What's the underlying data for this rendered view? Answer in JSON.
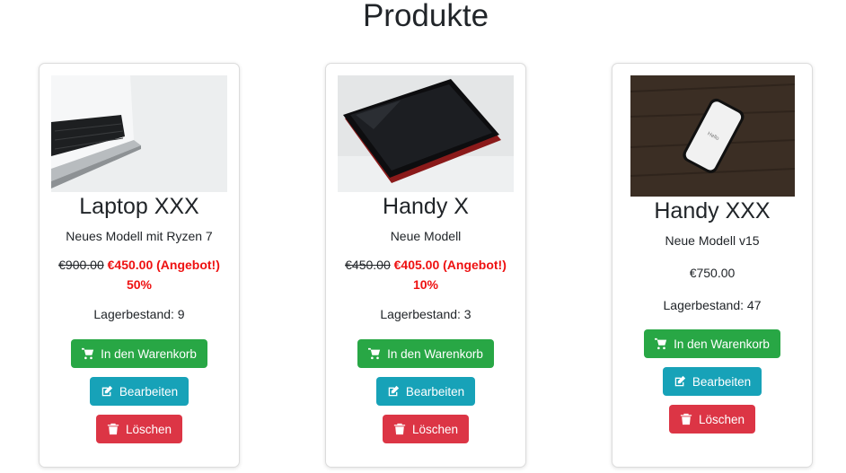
{
  "page": {
    "title": "Produkte"
  },
  "products": [
    {
      "name": "Laptop XXX",
      "description": "Neues Modell mit Ryzen 7",
      "old_price": "€900.00",
      "new_price": "€450.00 (Angebot!)",
      "discount": "50%",
      "stock": "Lagerbestand: 9",
      "image_icon": "laptop-photo"
    },
    {
      "name": "Handy X",
      "description": "Neue Modell",
      "old_price": "€450.00",
      "new_price": "€405.00 (Angebot!)",
      "discount": "10%",
      "stock": "Lagerbestand: 3",
      "image_icon": "phone-photo"
    },
    {
      "name": "Handy XXX",
      "description": "Neue Modell v15",
      "price": "€750.00",
      "stock": "Lagerbestand: 47",
      "image_icon": "phone-on-wood-photo",
      "image_screen_text": "Hello"
    }
  ],
  "buttons": {
    "cart_label": "In den Warenkorb",
    "edit_label": "Bearbeiten",
    "delete_label": "Löschen"
  },
  "colors": {
    "cart": "#28a745",
    "edit": "#17a2b8",
    "delete": "#dc3545",
    "offer": "#e11111"
  },
  "icons": {
    "cart": "cart-icon",
    "edit": "edit-icon",
    "delete": "trash-icon"
  }
}
